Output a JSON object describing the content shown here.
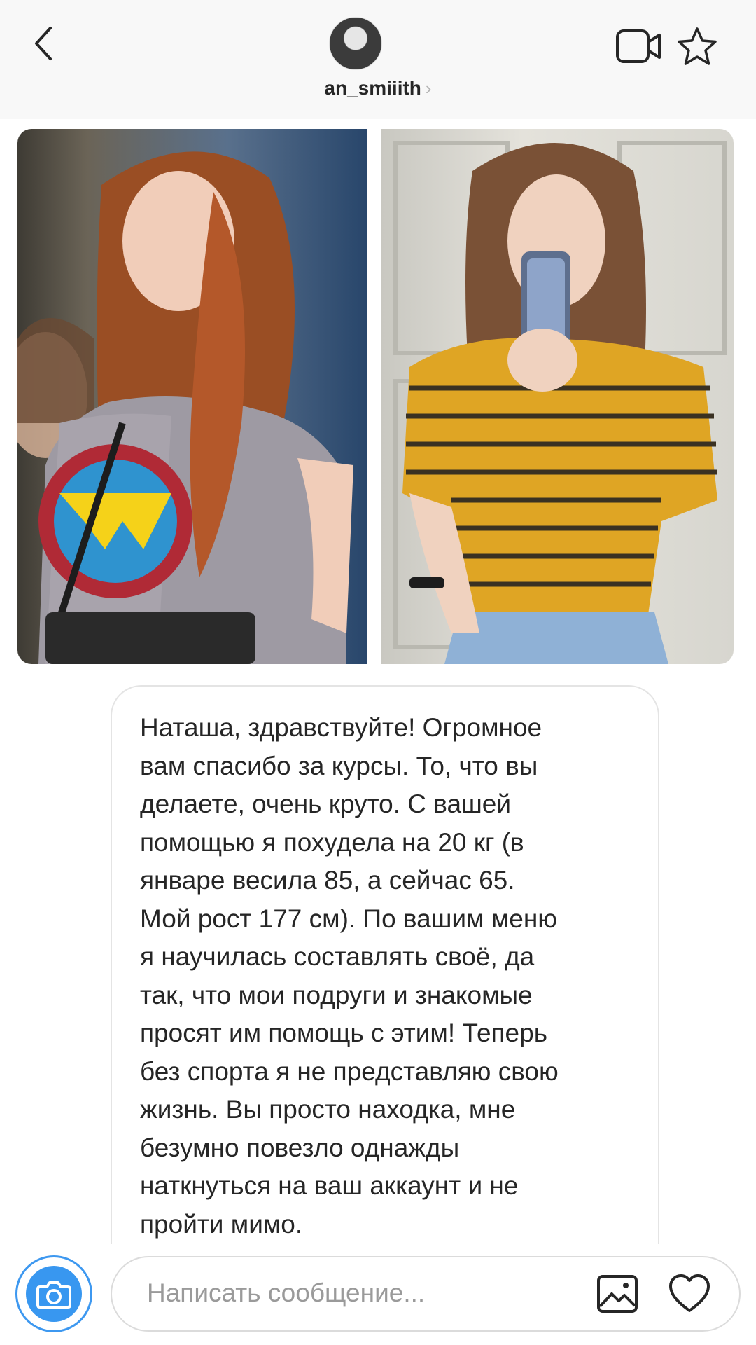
{
  "header": {
    "username": "an_smiiith",
    "username_chevron": "›",
    "icons": {
      "back": "chevron-left-icon",
      "video_call": "video-camera-icon",
      "favorite": "star-outline-icon"
    }
  },
  "thread": {
    "photo_message": {
      "description_left": "before-photo",
      "description_right": "after-photo"
    },
    "text_message": "Наташа, здравствуйте! Огромное\nвам спасибо за курсы. То, что вы\nделаете, очень круто. С вашей\nпомощью я похудела на 20 кг (в\nянваре весила 85, а сейчас 65.\nМой рост 177 см). По вашим меню\nя научилась составлять своё, да\nтак, что мои подруги и знакомые\nпросят им помощь с этим! Теперь\nбез спорта я не представляю свою\nжизнь. Вы просто находка, мне\nбезумно повезло однажды\nнаткнуться на ваш аккаунт и не\nпройти мимо."
  },
  "composer": {
    "placeholder": "Написать сообщение...",
    "icons": {
      "camera": "camera-icon",
      "gallery": "image-gallery-icon",
      "like": "heart-outline-icon"
    },
    "accent_color": "#3897f0"
  }
}
